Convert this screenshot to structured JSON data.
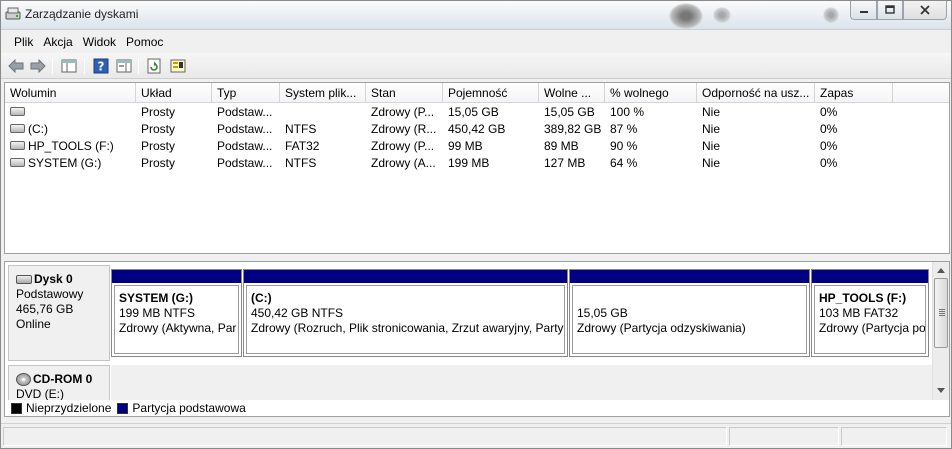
{
  "window": {
    "title": "Zarządzanie dyskami"
  },
  "menu": [
    "Plik",
    "Akcja",
    "Widok",
    "Pomoc"
  ],
  "toolbar": {
    "icons": [
      "back-arrow-icon",
      "forward-arrow-icon",
      "console-tree-icon",
      "help-icon",
      "panel-icon",
      "refresh-icon",
      "properties-icon"
    ]
  },
  "volumes": {
    "headers": [
      "Wolumin",
      "Układ",
      "Typ",
      "System plik...",
      "Stan",
      "Pojemność",
      "Wolne ...",
      "% wolnego",
      "Odporność na usz...",
      "Zapas"
    ],
    "rows": [
      [
        "",
        "Prosty",
        "Podstaw...",
        "",
        "Zdrowy (P...",
        "15,05 GB",
        "15,05 GB",
        "100 %",
        "Nie",
        "0%"
      ],
      [
        "(C:)",
        "Prosty",
        "Podstaw...",
        "NTFS",
        "Zdrowy (R...",
        "450,42 GB",
        "389,82 GB",
        "87 %",
        "Nie",
        "0%"
      ],
      [
        "HP_TOOLS (F:)",
        "Prosty",
        "Podstaw...",
        "FAT32",
        "Zdrowy (P...",
        "99 MB",
        "89 MB",
        "90 %",
        "Nie",
        "0%"
      ],
      [
        "SYSTEM (G:)",
        "Prosty",
        "Podstaw...",
        "NTFS",
        "Zdrowy (A...",
        "199 MB",
        "127 MB",
        "64 %",
        "Nie",
        "0%"
      ]
    ]
  },
  "disk0": {
    "name": "Dysk 0",
    "type": "Podstawowy",
    "size": "465,76 GB",
    "status": "Online",
    "partitions": [
      {
        "title": "SYSTEM  (G:)",
        "size": "199 MB NTFS",
        "status": "Zdrowy (Aktywna, Par"
      },
      {
        "title": "(C:)",
        "size": "450,42 GB NTFS",
        "status": "Zdrowy (Rozruch, Plik stronicowania, Zrzut awaryjny, Partycj"
      },
      {
        "title": "",
        "size": "15,05 GB",
        "status": "Zdrowy (Partycja odzyskiwania)"
      },
      {
        "title": "HP_TOOLS  (F:)",
        "size": "103 MB FAT32",
        "status": "Zdrowy (Partycja po"
      }
    ]
  },
  "cdrom0": {
    "name": "CD-ROM 0",
    "drive": "DVD (E:)"
  },
  "legend": [
    {
      "label": "Nieprzydzielone",
      "color": "#000000"
    },
    {
      "label": "Partycja podstawowa",
      "color": "#000080"
    }
  ]
}
